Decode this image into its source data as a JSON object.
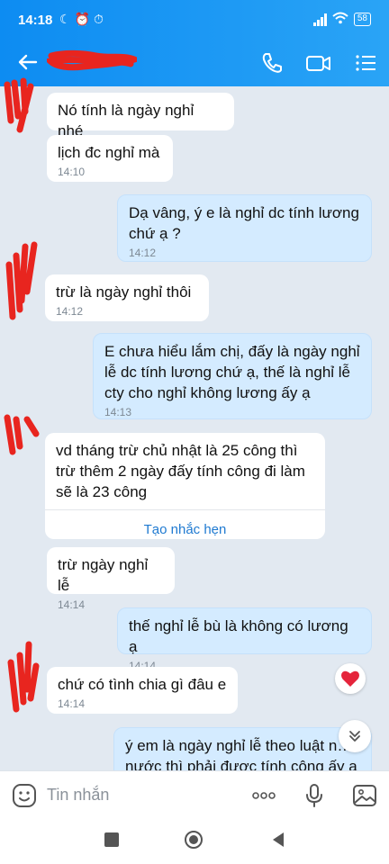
{
  "status_bar": {
    "time": "14:18",
    "signal": "4G",
    "battery": "58"
  },
  "header": {
    "contact_name": ""
  },
  "messages": [
    {
      "side": "in",
      "text": "Nó tính là ngày nghỉ nhé",
      "time": ""
    },
    {
      "side": "in",
      "text": "lịch đc nghỉ mà",
      "time": "14:10"
    },
    {
      "side": "out",
      "text": "Dạ vâng, ý e là nghỉ dc tính lương chứ ạ ?",
      "time": "14:12"
    },
    {
      "side": "in",
      "text": "trừ là  ngày nghỉ thôi",
      "time": "14:12"
    },
    {
      "side": "out",
      "text": "E chưa hiểu lắm chị, đấy là ngày nghỉ lễ dc tính lương chứ ạ, thế là nghỉ lễ cty cho nghỉ không lương ấy ạ",
      "time": "14:13"
    },
    {
      "side": "in",
      "text": "vd tháng trừ chủ nhật là 25 công thì trừ thêm 2 ngày đấy tính công đi làm sẽ là 23 công",
      "time": "",
      "action": "Tạo nhắc hẹn"
    },
    {
      "side": "in",
      "text": "trừ ngày nghỉ lễ",
      "time": "14:14"
    },
    {
      "side": "out",
      "text": "thế nghỉ lễ bù là không có lương ạ",
      "time": "14:14"
    },
    {
      "side": "in",
      "text": "chứ có tình chia gì đâu e",
      "time": "14:14"
    },
    {
      "side": "out",
      "text": "ý em là ngày nghỉ lễ theo luật n… nước thì phải được tính công ấy a",
      "time": ""
    }
  ],
  "input": {
    "placeholder": "Tin nhắn"
  },
  "colors": {
    "header": "#1a94f4",
    "incoming": "#ffffff",
    "outgoing": "#d4ebff",
    "redaction": "#e8251f"
  }
}
